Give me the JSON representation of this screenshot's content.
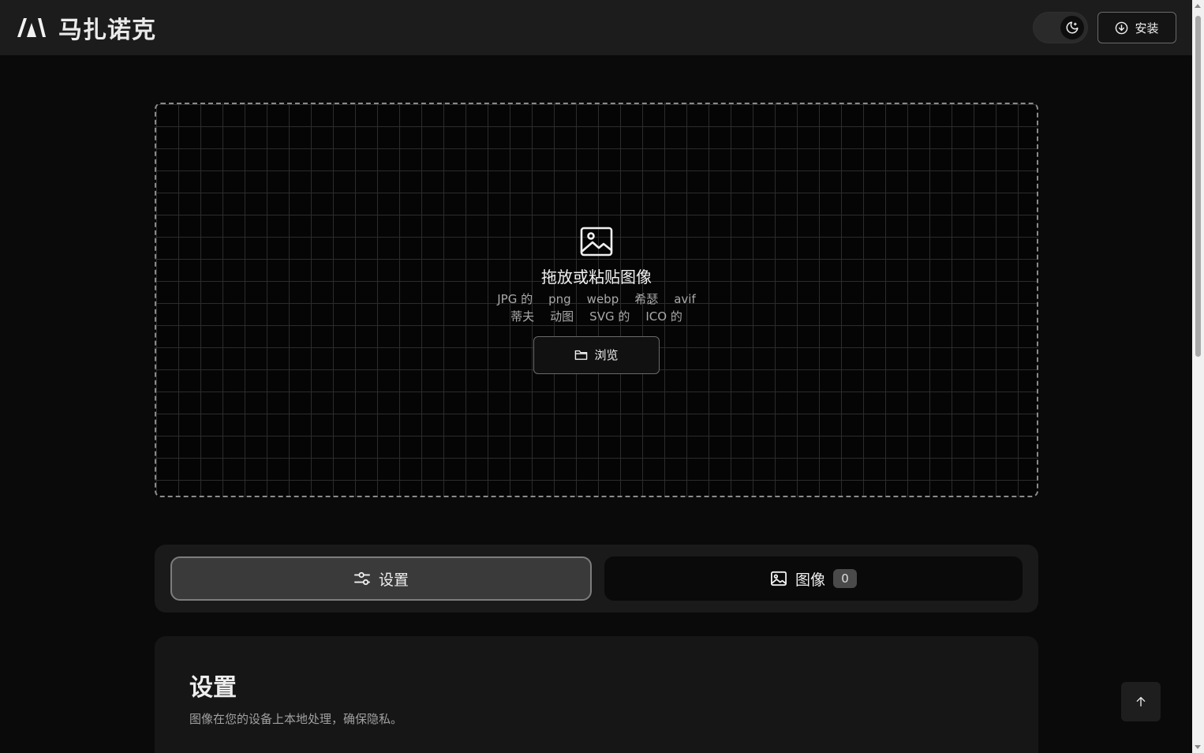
{
  "header": {
    "brand_name": "马扎诺克",
    "logo_icon": "m-logo-icon",
    "theme_toggle_icon": "moon-icon",
    "install_label": "安装",
    "install_icon": "download-circle-icon"
  },
  "dropzone": {
    "icon": "image-icon",
    "title": "拖放或粘贴图像",
    "formats_row1": [
      "JPG 的",
      "png",
      "webp",
      "希瑟",
      "avif"
    ],
    "formats_row2": [
      "蒂夫",
      "动图",
      "SVG 的",
      "ICO 的"
    ],
    "browse_label": "浏览",
    "browse_icon": "folder-icon"
  },
  "tabs": {
    "settings_label": "设置",
    "settings_icon": "sliders-icon",
    "images_label": "图像",
    "images_icon": "image-icon",
    "images_count": "0"
  },
  "settings_panel": {
    "title": "设置",
    "description": "图像在您的设备上本地处理，确保隐私。"
  },
  "back_to_top_icon": "arrow-up-icon",
  "colors": {
    "background": "#0a0a0a",
    "header": "#1c1c1c",
    "active_tab": "#3a3a3a"
  }
}
